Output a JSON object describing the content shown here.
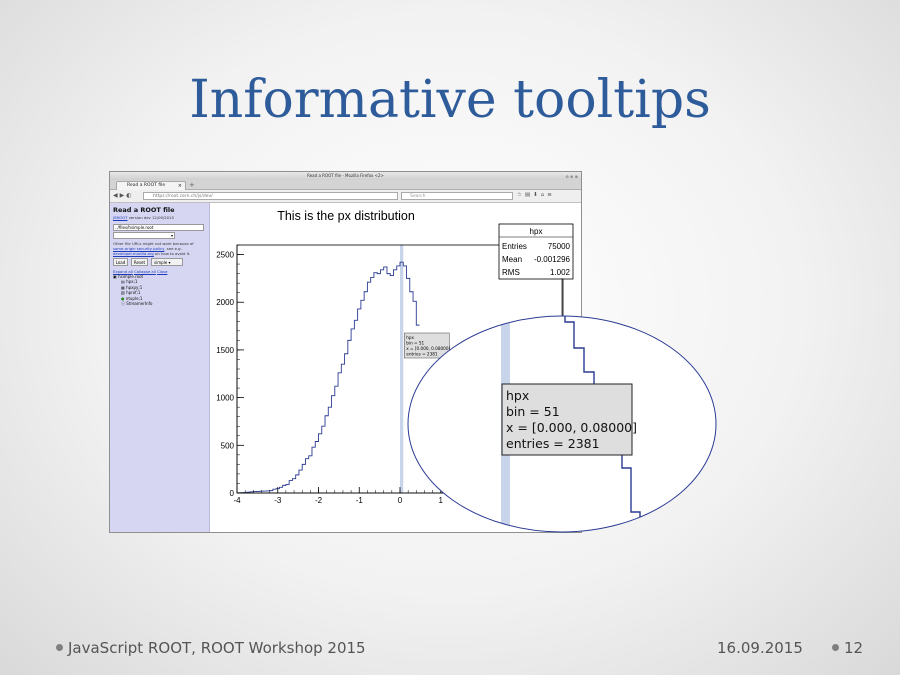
{
  "slide": {
    "title": "Informative tooltips",
    "footer_left": "JavaScript ROOT, ROOT Workshop 2015",
    "footer_date": "16.09.2015",
    "page_number": "12",
    "title_color": "#2e5b9a"
  },
  "browser": {
    "window_title": "Read a ROOT file - Mozilla Firefox <2>",
    "tab_label": "Read a ROOT file",
    "url": "https://root.cern.ch/js/dev/",
    "search_placeholder": "Search"
  },
  "sidebar": {
    "title": "Read a ROOT file",
    "version_link": "JSROOT",
    "version_text": "version dev 12/09/2015",
    "file_input": "../files/hsimple.root",
    "note_line1": "Other file URLs might not work because of",
    "note_link1": "same-origin security policy",
    "note_line2_suffix": ", see e.g.",
    "note_link2": "developer.mozilla.org",
    "note_line2_end": "on how to avoid it.",
    "buttons": [
      "Load",
      "Reset",
      "simple"
    ],
    "links": [
      "Expand all",
      "Collapse all",
      "Close"
    ],
    "tree_root": "hsimple.root",
    "tree_items": [
      "hpx;1",
      "hpxpy;1",
      "hprof;1",
      "ntuple;1",
      "StreamerInfo"
    ]
  },
  "chart_data": {
    "type": "bar",
    "title": "This is the px distribution",
    "xlim": [
      -4,
      4
    ],
    "ylim": [
      0,
      2600
    ],
    "x_ticks": [
      "-4",
      "-3",
      "-2",
      "-1",
      "0",
      "1"
    ],
    "y_ticks": [
      "0",
      "500",
      "1000",
      "1500",
      "2000",
      "2500"
    ],
    "bin_low": -4,
    "bin_width": 0.08,
    "values": [
      2,
      3,
      5,
      8,
      12,
      15,
      16,
      19,
      20,
      22,
      25,
      40,
      45,
      60,
      80,
      90,
      130,
      150,
      190,
      240,
      300,
      360,
      390,
      480,
      540,
      620,
      700,
      810,
      900,
      1020,
      1120,
      1260,
      1350,
      1460,
      1600,
      1720,
      1810,
      1930,
      2020,
      2110,
      2210,
      2260,
      2310,
      2300,
      2340,
      2370,
      2300,
      2280,
      2340,
      2381,
      2420,
      2381,
      2250,
      2110,
      2010,
      1760
    ],
    "highlighted_bin": 50,
    "highlight_color": "#c8d4ea",
    "line_color": "#2b3b94",
    "stats": {
      "name": "hpx",
      "rows": [
        [
          "Entries",
          "75000"
        ],
        [
          "Mean",
          "-0.001296"
        ],
        [
          "RMS",
          "1.002"
        ]
      ]
    },
    "tooltip_small": [
      "hpx",
      "bin = 51",
      "x = [0.000, 0.08000]",
      "entries = 2381"
    ]
  },
  "zoom": {
    "tooltip": [
      "hpx",
      "bin = 51",
      "x = [0.000, 0.08000]",
      "entries = 2381"
    ],
    "tooltip_bg": "#dedede",
    "outline_color": "#2b3b94"
  }
}
